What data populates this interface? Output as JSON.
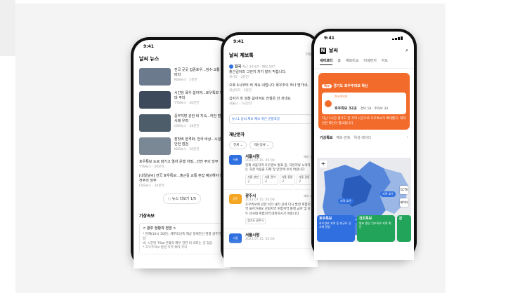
{
  "phone1": {
    "time": "9:41",
    "title": "날씨 뉴스",
    "news": [
      {
        "title": "전국 곳곳 집중호우...침수·교통 잇따라",
        "meta": "KBS뉴스 · 5분전"
      },
      {
        "title": "시간당 폭우 쏟아져...호우특보 확대 주의",
        "meta": "YTN뉴스 · 30분전"
      },
      {
        "title": "중부지방 강한 비 지속...하천 범람 사태 우려",
        "meta": "CBS뉴스 · 30분전"
      },
      {
        "title": "장맛비 본격화, 전국 비상...시설물 안전 점검",
        "meta": "KBS뉴스 · 10분전"
      }
    ],
    "text_news": [
      {
        "title": "호우특보 도로 잠기고 열차 운행 차질...안전 주의 당부",
        "meta": "YTN뉴스 · 20분전"
      },
      {
        "title": "[내일날씨] 전국 호우특보...출근길 교통 혼잡 예상해야 안전주의 당부",
        "meta": "CBS뉴스 · 30분전"
      }
    ],
    "more": "◌ 뉴스 더보기 1/5",
    "section": "기상속보",
    "memo_title": "< 광주 현황과 전망 >",
    "memo_lines": [
      "* 현재(10시 30분), 제주도남쪽 해상 정체전선 영향 광주전남",
      "비, 시간당 70㎜ 안팎의 매우 강한 비 내리는 곳 있음",
      "* 호우주의보 발령 지역 확대 주의"
    ]
  },
  "phone2": {
    "time": "9:41",
    "title": "날씨 제보톡",
    "more": "더보",
    "items": [
      {
        "title": "전국",
        "meta": "최근 24시간 · 제보 107",
        "lines": [
          "출근길이라 그런지 차가 많이 막힙니다.",
          "경기도 · 2분전"
        ]
      },
      {
        "lines": [
          "오후 4시부터 비 계속 내립니다 폭우주의 하나 명가네..",
          "경상북도 · 5분전"
        ]
      },
      {
        "lines": [
          "갑자기 비 엄청 쏟아져요 전철은 안 차네요",
          "서울시 · 7시간전"
        ]
      }
    ],
    "tag": "뉴스1 날씨 제보 제보 혹은 분할포장",
    "disaster_title": "재난문자",
    "chips": [
      "전체 ⌄",
      "재난종류 ⌄"
    ],
    "alerts": [
      {
        "icon": "서울",
        "color": "#2f6fe0",
        "org": "서울시청",
        "time": "2023.07.15. 05:00",
        "text": "현재 서울지역 호우경보 발표 중, 하천저류 노약자는 하천 이용을 자제 및 안전에 유의 바랍니다.",
        "tags": [
          "서울 양천구",
          "서울 관악구",
          "서울 중랑구",
          "서울 강동구"
        ],
        "count": "제보 >"
      },
      {
        "icon": "광주",
        "color": "#f5a623",
        "org": "광주시",
        "time": "2023.07.15. 05:00",
        "text": "호우특보에 강한 비가 내리 상세 다시 발령 위험지역 들어가세요 산립지역 위험지역 통행 금지 및 모두 산사태 위험지역 대피하시기 바랍니다.",
        "tags": [
          "경기도 광주시"
        ],
        "count": "제보 >"
      },
      {
        "icon": "서울",
        "color": "#2f6fe0",
        "org": "서울시청",
        "time": "2023.07.15. 05:00",
        "text": "",
        "tags": [],
        "count": ""
      }
    ]
  },
  "phone3": {
    "time": "9:41",
    "title": "날씨",
    "tabs": [
      "세이프티",
      "홈",
      "예보비교",
      "미세먼지",
      "지도"
    ],
    "alert_badge": "특보",
    "alert_head": "경기도 호우주의보 확산",
    "warn_label": "호우주의보",
    "warn_value": "호우특보 32곳",
    "warn_sub": "경보 18 · 주의보 34",
    "desc": "지난 1시간 경기도 전 지역 시간으로 호우특보가 확대됐고, 대피안전 확인이 필요합니다.",
    "subtabs": [
      "기상특보",
      "예보·관측",
      "위성·레이더"
    ],
    "map_labels": [
      "지역 호우",
      "지역 호우",
      "지역 호우"
    ],
    "map_buttons": [
      "CCTV",
      "레이더"
    ],
    "cards": [
      {
        "title": "호우특보",
        "text": "호우경보 지역 등 대규모 산사태 알림",
        "color": "#2f6fe0"
      },
      {
        "title": "건조특보",
        "text": "발표 중인 건조특보 지역 확인",
        "color": "#22a55b"
      },
      {
        "title": "강",
        "text": "",
        "color": "#22a55b"
      }
    ]
  }
}
